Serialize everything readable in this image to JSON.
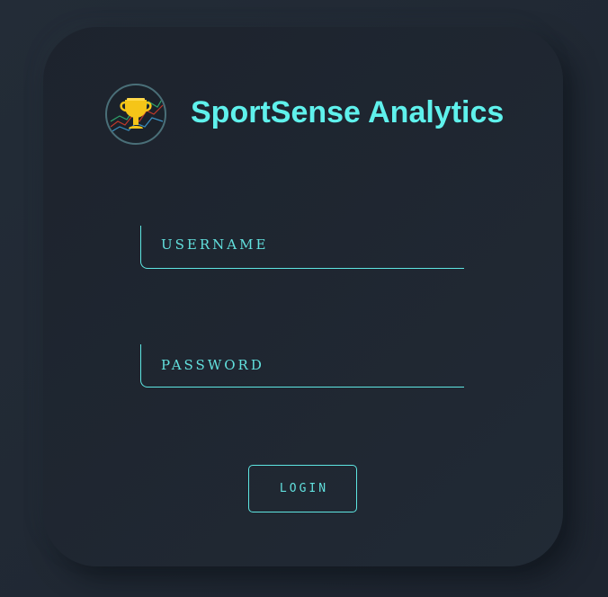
{
  "brand": {
    "title": "SportSense Analytics",
    "logo_icon": "trophy-chart-icon"
  },
  "form": {
    "username_label": "USERNAME",
    "password_label": "PASSWORD",
    "login_label": "LOGIN"
  },
  "colors": {
    "accent": "#5ff1ec",
    "background": "#212934",
    "card": "#1f2630",
    "trophy": "#f5c518"
  }
}
